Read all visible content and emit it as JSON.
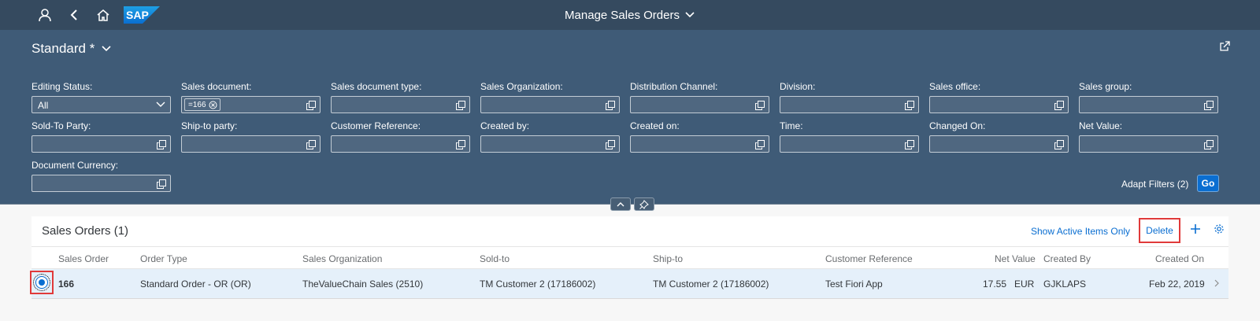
{
  "shell": {
    "title": "Manage Sales Orders",
    "logo_text": "SAP",
    "icons": [
      "user-icon",
      "back-icon",
      "home-icon",
      "chevron-down-icon"
    ]
  },
  "header": {
    "variant": "Standard *",
    "filters": [
      {
        "label": "Editing Status:",
        "value": "All"
      },
      {
        "label": "Sales document:",
        "value": "",
        "token": "=166"
      },
      {
        "label": "Sales document type:",
        "value": ""
      },
      {
        "label": "Sales Organization:",
        "value": ""
      },
      {
        "label": "Distribution Channel:",
        "value": ""
      },
      {
        "label": "Division:",
        "value": ""
      },
      {
        "label": "Sales office:",
        "value": ""
      },
      {
        "label": "Sales group:",
        "value": ""
      },
      {
        "label": "Sold-To Party:",
        "value": ""
      },
      {
        "label": "Ship-to party:",
        "value": ""
      },
      {
        "label": "Customer Reference:",
        "value": ""
      },
      {
        "label": "Created by:",
        "value": ""
      },
      {
        "label": "Created on:",
        "value": ""
      },
      {
        "label": "Time:",
        "value": ""
      },
      {
        "label": "Changed On:",
        "value": ""
      },
      {
        "label": "Net Value:",
        "value": ""
      },
      {
        "label": "Document Currency:",
        "value": ""
      }
    ],
    "adapt_filters": "Adapt Filters (2)",
    "go": "Go"
  },
  "table": {
    "title": "Sales Orders (1)",
    "show_active": "Show Active Items Only",
    "delete": "Delete",
    "columns": [
      "Sales Order",
      "Order Type",
      "Sales Organization",
      "Sold-to",
      "Ship-to",
      "Customer Reference",
      "Net Value",
      "Created By",
      "Created On"
    ],
    "rows": [
      {
        "sales_order": "166",
        "order_type": "Standard Order - OR (OR)",
        "sales_org": "TheValueChain Sales (2510)",
        "sold_to": "TM Customer 2 (17186002)",
        "ship_to": "TM Customer 2 (17186002)",
        "customer_ref": "Test Fiori App",
        "net_value": "17.55",
        "currency": "EUR",
        "created_by": "GJKLAPS",
        "created_on": "Feb 22, 2019"
      }
    ]
  },
  "colors": {
    "shell_bg": "#354a5f",
    "header_bg": "#3f5b77",
    "accent": "#0a6ed1",
    "highlight": "#e03a3a",
    "selected_row": "#e5f0fa"
  }
}
